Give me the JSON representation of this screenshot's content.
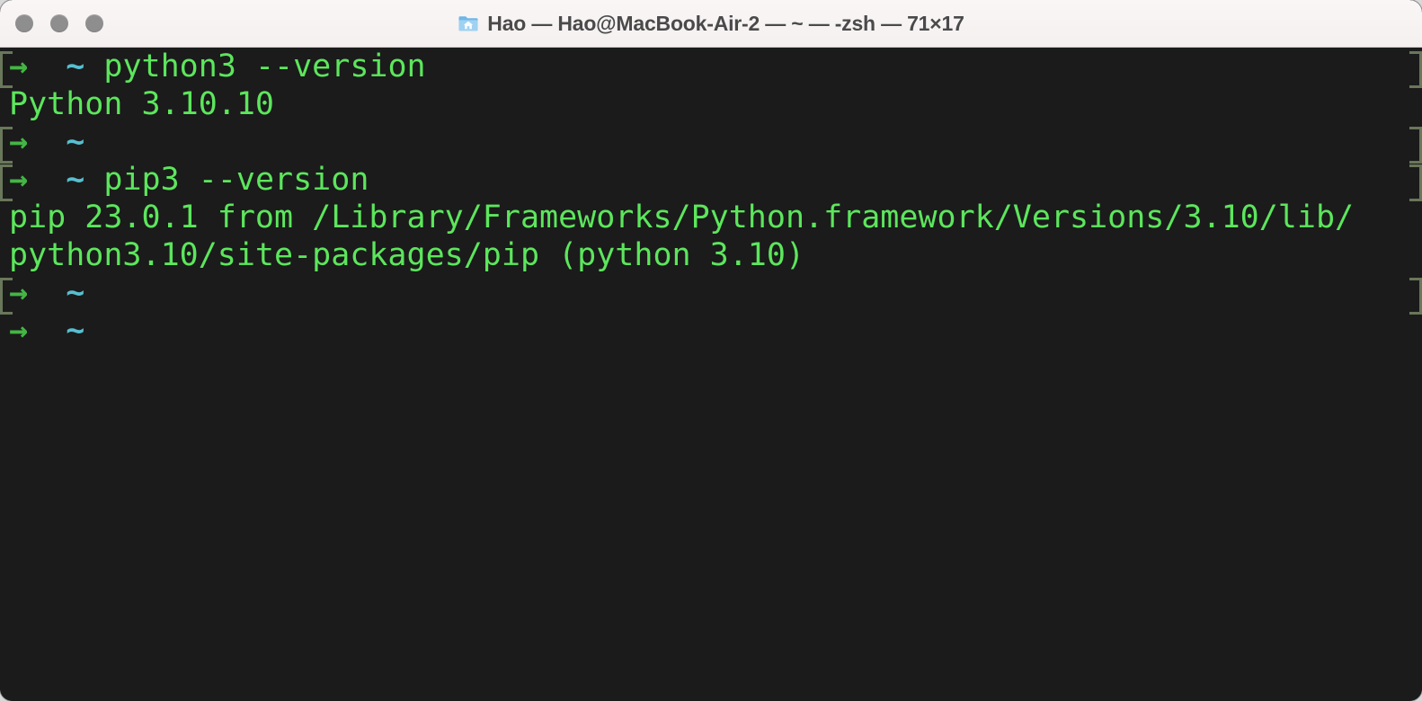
{
  "window": {
    "title": "Hao — Hao@MacBook-Air-2 — ~ — -zsh — 71×17",
    "icon": "home-folder-icon",
    "traffic_lights": [
      {
        "name": "close-button",
        "label": "Close",
        "color": "#8e8e8e"
      },
      {
        "name": "minimize-button",
        "label": "Minimize",
        "color": "#8e8e8e"
      },
      {
        "name": "zoom-button",
        "label": "Zoom",
        "color": "#8e8e8e"
      }
    ],
    "columns": 71,
    "rows": 17
  },
  "colors": {
    "titlebar_bg": "#f8f4f4",
    "titlebar_text": "#4a4a4a",
    "terminal_bg": "#1b1b1b",
    "output_green": "#5ce65c",
    "prompt_arrow_green": "#44b544",
    "prompt_tilde_cyan": "#56bfd0",
    "prompt_mark": "#69775a"
  },
  "prompt": {
    "arrow": "→",
    "gap": "  ",
    "path": "~",
    "trailing_space": " "
  },
  "terminal": {
    "lines": [
      {
        "kind": "prompt",
        "mark": true,
        "command": "python3 --version"
      },
      {
        "kind": "output",
        "mark": false,
        "text": "Python 3.10.10"
      },
      {
        "kind": "prompt",
        "mark": true,
        "command": ""
      },
      {
        "kind": "prompt",
        "mark": true,
        "command": "pip3 --version"
      },
      {
        "kind": "output",
        "mark": false,
        "text": "pip 23.0.1 from /Library/Frameworks/Python.framework/Versions/3.10/lib/"
      },
      {
        "kind": "output",
        "mark": false,
        "text": "python3.10/site-packages/pip (python 3.10)"
      },
      {
        "kind": "prompt",
        "mark": true,
        "command": ""
      },
      {
        "kind": "prompt",
        "mark": false,
        "command": ""
      }
    ]
  }
}
